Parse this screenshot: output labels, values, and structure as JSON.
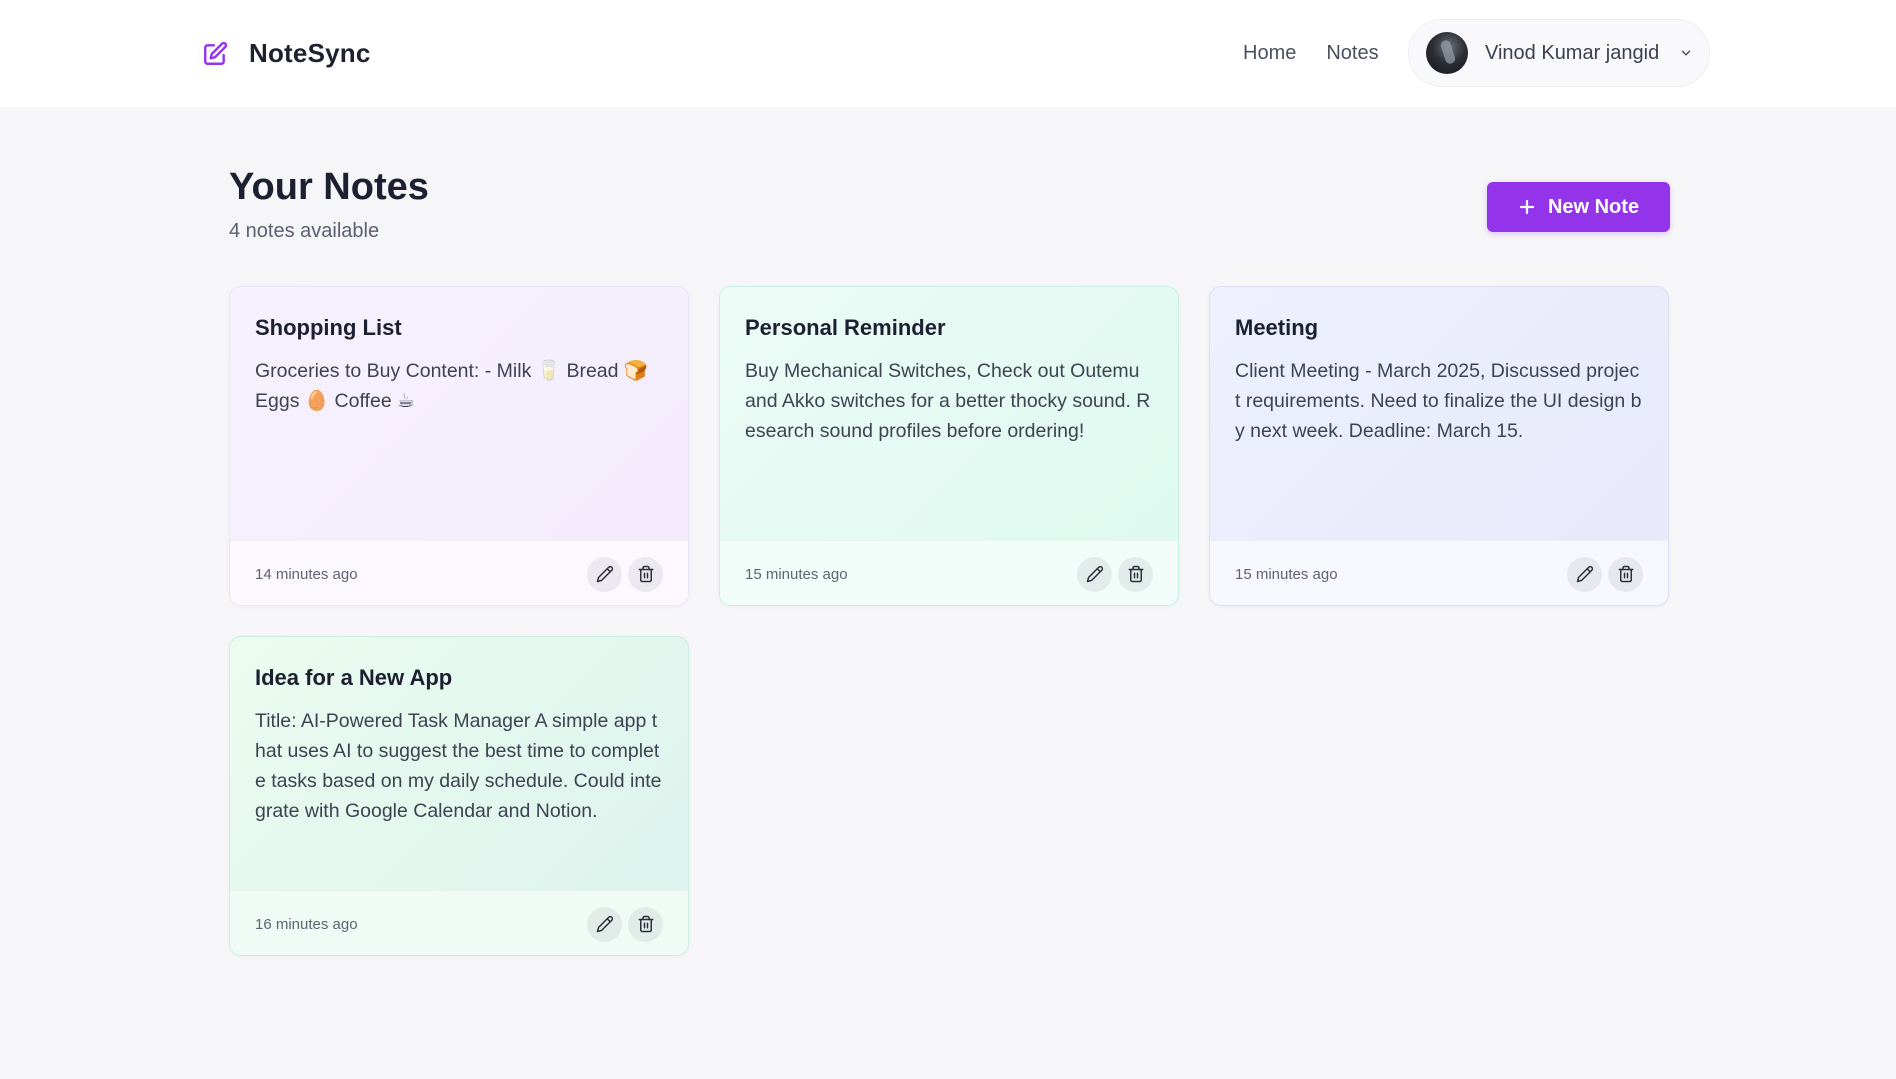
{
  "header": {
    "brand_icon": "edit-square-icon",
    "brand_name": "NoteSync",
    "nav": [
      {
        "label": "Home"
      },
      {
        "label": "Notes"
      }
    ],
    "user": {
      "name": "Vinod Kumar jangid",
      "avatar_icon": "user-avatar",
      "menu_icon": "chevron-down-icon"
    }
  },
  "page": {
    "title": "Your Notes",
    "count_text": "4 notes available",
    "new_note_label": "New Note",
    "new_note_icon": "plus-icon",
    "accent_color": "#9333ea"
  },
  "notes": [
    {
      "title": "Shopping List",
      "content": "Groceries to Buy Content: - Milk 🥛 Bread 🍞 Eggs 🥚 Coffee ☕",
      "time": "14 minutes ago",
      "color": "#f3ebfc"
    },
    {
      "title": "Personal Reminder",
      "content": "Buy Mechanical Switches, Check out Outemu and Akko switches for a better thocky sound. Research sound profiles before ordering!",
      "time": "15 minutes ago",
      "color": "#dcf9ef"
    },
    {
      "title": "Meeting",
      "content": "Client Meeting - March 2025, Discussed project requirements. Need to finalize the UI design by next week. Deadline: March 15.",
      "time": "15 minutes ago",
      "color": "#e7e9fc"
    },
    {
      "title": "Idea for a New App",
      "content": "Title: AI-Powered Task Manager A simple app that uses AI to suggest the best time to complete tasks based on my daily schedule. Could integrate with Google Calendar and Notion.",
      "time": "16 minutes ago",
      "color": "#e2f7ee"
    }
  ],
  "card_actions": {
    "edit_icon": "pencil-icon",
    "delete_icon": "trash-icon"
  }
}
